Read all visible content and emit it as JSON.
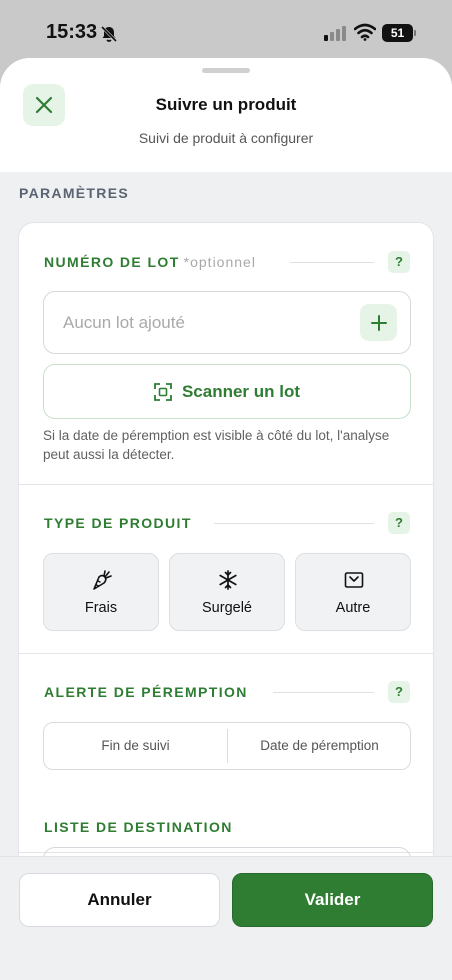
{
  "status_bar": {
    "time": "15:33",
    "battery": "51",
    "icons": [
      "bell-slash-icon",
      "signal-icon",
      "wifi-icon",
      "battery-icon"
    ]
  },
  "sheet": {
    "title": "Suivre un produit",
    "subtitle": "Suivi de produit à configurer",
    "close_icon": "close-icon"
  },
  "params": {
    "section_title": "PARAMÈTRES",
    "lot": {
      "label": "NUMÉRO DE LOT",
      "optional": "*optionnel",
      "help": "?",
      "placeholder": "Aucun lot ajouté",
      "add_icon": "plus-icon",
      "scan_label": "Scanner un lot",
      "scan_icon": "scan-icon",
      "hint": "Si la date de péremption est visible à côté du lot, l'analyse peut aussi la détecter."
    },
    "product_type": {
      "label": "TYPE DE PRODUIT",
      "help": "?",
      "options": [
        {
          "label": "Frais",
          "icon": "carrot-icon"
        },
        {
          "label": "Surgelé",
          "icon": "snowflake-icon"
        },
        {
          "label": "Autre",
          "icon": "box-icon"
        }
      ]
    },
    "expiry_alert": {
      "label": "ALERTE DE PÉREMPTION",
      "help": "?",
      "options": [
        "Fin de suivi",
        "Date de péremption"
      ]
    },
    "destination": {
      "label": "LISTE DE DESTINATION"
    }
  },
  "footer": {
    "cancel_label": "Annuler",
    "validate_label": "Valider"
  },
  "colors": {
    "accent": "#2e7d32",
    "accent_light": "#e5f4e7",
    "background": "#eef0f2"
  }
}
